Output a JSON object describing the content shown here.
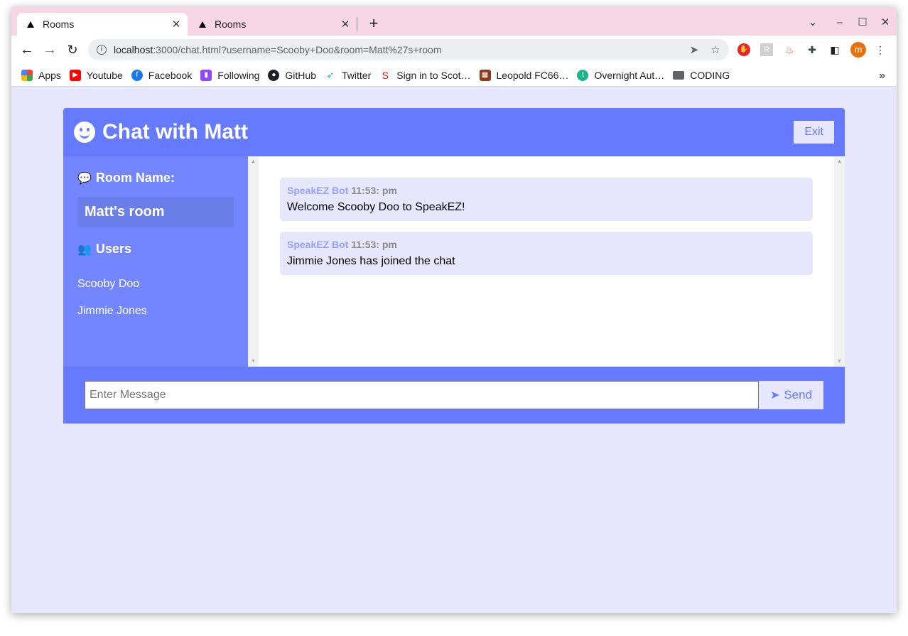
{
  "browser": {
    "tabs": [
      {
        "title": "Rooms"
      },
      {
        "title": "Rooms"
      }
    ],
    "url_host": "localhost",
    "url_path": ":3000/chat.html?username=Scooby+Doo&room=Matt%27s+room",
    "bookmarks": [
      {
        "label": "Apps",
        "icon": "apps-grid-icon",
        "color": "#e8453c"
      },
      {
        "label": "Youtube",
        "icon": "youtube-icon",
        "color": "#ff0000"
      },
      {
        "label": "Facebook",
        "icon": "facebook-icon",
        "color": "#1877f2"
      },
      {
        "label": "Following",
        "icon": "twitch-icon",
        "color": "#9146ff"
      },
      {
        "label": "GitHub",
        "icon": "github-icon",
        "color": "#202124"
      },
      {
        "label": "Twitter",
        "icon": "twitter-icon",
        "color": "#1da1f2"
      },
      {
        "label": "Sign in to Scot…",
        "icon": "scotiabank-icon",
        "color": "#ec111a"
      },
      {
        "label": "Leopold FC66…",
        "icon": "leopold-icon",
        "color": "#8b3a1a"
      },
      {
        "label": "Overnight Aut…",
        "icon": "overnight-icon",
        "color": "#1fb58a"
      },
      {
        "label": "CODING",
        "icon": "folder-icon",
        "color": "#5f6368"
      }
    ],
    "more": "»"
  },
  "chat": {
    "title": "Chat with Matt",
    "exit_label": "Exit",
    "room_heading": "Room Name:",
    "room_name": "Matt's room",
    "users_heading": "Users",
    "users": [
      "Scooby Doo",
      "Jimmie Jones"
    ],
    "messages": [
      {
        "sender": "SpeakEZ Bot",
        "time": "11:53: pm",
        "text": "Welcome Scooby Doo to SpeakEZ!"
      },
      {
        "sender": "SpeakEZ Bot",
        "time": "11:53: pm",
        "text": "Jimmie Jones has joined the chat"
      }
    ],
    "input_placeholder": "Enter Message",
    "send_label": "Send"
  },
  "colors": {
    "primary": "#667aff",
    "secondary": "#7386ff",
    "light": "#e6e6fd"
  }
}
